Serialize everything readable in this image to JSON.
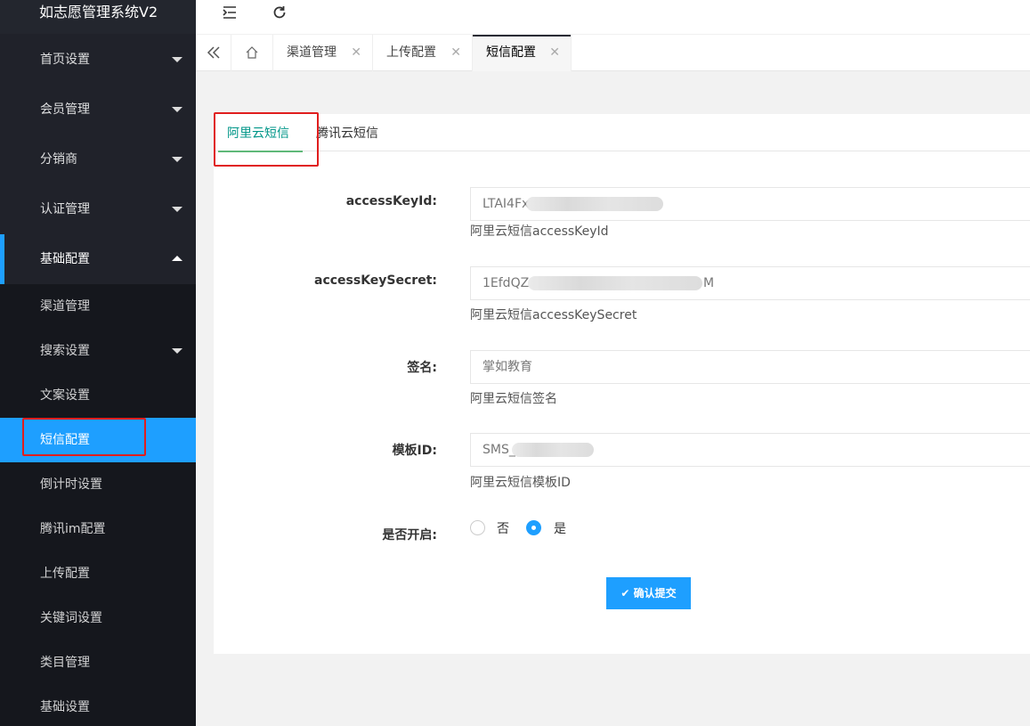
{
  "app": {
    "title": "如志愿管理系统V2"
  },
  "sidebar": {
    "items": [
      {
        "label": "首页设置"
      },
      {
        "label": "会员管理"
      },
      {
        "label": "分销商"
      },
      {
        "label": "认证管理"
      },
      {
        "label": "基础配置"
      }
    ],
    "subitems": [
      {
        "label": "渠道管理"
      },
      {
        "label": "搜索设置"
      },
      {
        "label": "文案设置"
      },
      {
        "label": "短信配置"
      },
      {
        "label": "倒计时设置"
      },
      {
        "label": "腾讯im配置"
      },
      {
        "label": "上传配置"
      },
      {
        "label": "关键词设置"
      },
      {
        "label": "类目管理"
      },
      {
        "label": "基础设置"
      }
    ]
  },
  "tabs": [
    {
      "label": "渠道管理"
    },
    {
      "label": "上传配置"
    },
    {
      "label": "短信配置"
    }
  ],
  "content": {
    "tabs": [
      {
        "label": "阿里云短信"
      },
      {
        "label": "腾讯云短信"
      }
    ],
    "fields": [
      {
        "label": "accessKeyId:",
        "value": "LTAI4Fx",
        "hint": "阿里云短信accessKeyId"
      },
      {
        "label": "accessKeySecret:",
        "value": "1EfdQZ",
        "value_tail": "M",
        "hint": "阿里云短信accessKeySecret"
      },
      {
        "label": "签名:",
        "value": "掌如教育",
        "hint": "阿里云短信签名"
      },
      {
        "label": "模板ID:",
        "value": "SMS_",
        "hint": "阿里云短信模板ID"
      }
    ],
    "enable": {
      "label": "是否开启:",
      "options": [
        {
          "label": "否"
        },
        {
          "label": "是"
        }
      ],
      "selected": "是"
    },
    "submit_label": "确认提交"
  },
  "colors": {
    "accent": "#1e9fff",
    "tab_active": "#009688",
    "sidebar_bg": "#20222a",
    "highlight_box": "#e01e1e"
  }
}
